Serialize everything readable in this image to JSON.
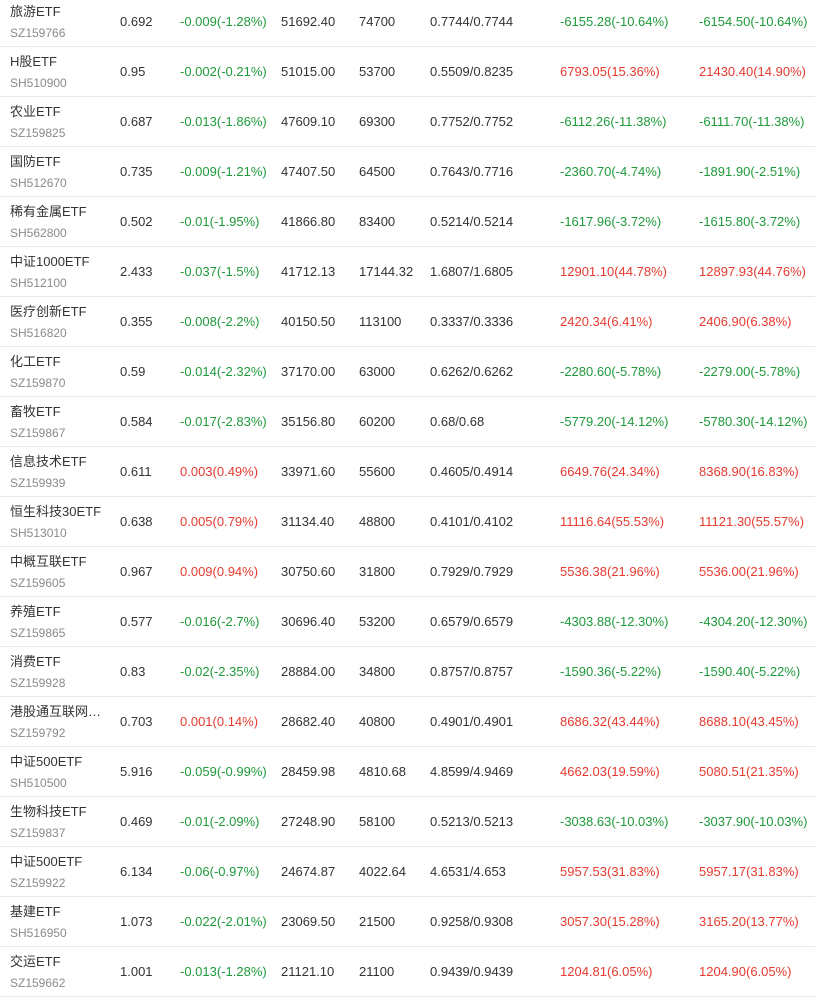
{
  "colors": {
    "up": "#e83a2e",
    "down": "#1f9a3b",
    "neutral": "#333333",
    "code_gray": "#8a8a8a",
    "divider": "#e8e8e8"
  },
  "rows": [
    {
      "name": "旅游ETF",
      "code": "SZ159766",
      "price": "0.692",
      "change": "-0.009(-1.28%)",
      "change_dir": "down",
      "market_value": "51692.40",
      "shares": "74700",
      "cost": "0.7744/0.7744",
      "pl1": "-6155.28(-10.64%)",
      "pl1_dir": "down",
      "pl2": "-6154.50(-10.64%)",
      "pl2_dir": "down"
    },
    {
      "name": "H股ETF",
      "code": "SH510900",
      "price": "0.95",
      "change": "-0.002(-0.21%)",
      "change_dir": "down",
      "market_value": "51015.00",
      "shares": "53700",
      "cost": "0.5509/0.8235",
      "pl1": "6793.05(15.36%)",
      "pl1_dir": "up",
      "pl2": "21430.40(14.90%)",
      "pl2_dir": "up"
    },
    {
      "name": "农业ETF",
      "code": "SZ159825",
      "price": "0.687",
      "change": "-0.013(-1.86%)",
      "change_dir": "down",
      "market_value": "47609.10",
      "shares": "69300",
      "cost": "0.7752/0.7752",
      "pl1": "-6112.26(-11.38%)",
      "pl1_dir": "down",
      "pl2": "-6111.70(-11.38%)",
      "pl2_dir": "down"
    },
    {
      "name": "国防ETF",
      "code": "SH512670",
      "price": "0.735",
      "change": "-0.009(-1.21%)",
      "change_dir": "down",
      "market_value": "47407.50",
      "shares": "64500",
      "cost": "0.7643/0.7716",
      "pl1": "-2360.70(-4.74%)",
      "pl1_dir": "down",
      "pl2": "-1891.90(-2.51%)",
      "pl2_dir": "down"
    },
    {
      "name": "稀有金属ETF",
      "code": "SH562800",
      "price": "0.502",
      "change": "-0.01(-1.95%)",
      "change_dir": "down",
      "market_value": "41866.80",
      "shares": "83400",
      "cost": "0.5214/0.5214",
      "pl1": "-1617.96(-3.72%)",
      "pl1_dir": "down",
      "pl2": "-1615.80(-3.72%)",
      "pl2_dir": "down"
    },
    {
      "name": "中证1000ETF",
      "code": "SH512100",
      "price": "2.433",
      "change": "-0.037(-1.5%)",
      "change_dir": "down",
      "market_value": "41712.13",
      "shares": "17144.32",
      "cost": "1.6807/1.6805",
      "pl1": "12901.10(44.78%)",
      "pl1_dir": "up",
      "pl2": "12897.93(44.76%)",
      "pl2_dir": "up"
    },
    {
      "name": "医疗创新ETF",
      "code": "SH516820",
      "price": "0.355",
      "change": "-0.008(-2.2%)",
      "change_dir": "down",
      "market_value": "40150.50",
      "shares": "113100",
      "cost": "0.3337/0.3336",
      "pl1": "2420.34(6.41%)",
      "pl1_dir": "up",
      "pl2": "2406.90(6.38%)",
      "pl2_dir": "up"
    },
    {
      "name": "化工ETF",
      "code": "SZ159870",
      "price": "0.59",
      "change": "-0.014(-2.32%)",
      "change_dir": "down",
      "market_value": "37170.00",
      "shares": "63000",
      "cost": "0.6262/0.6262",
      "pl1": "-2280.60(-5.78%)",
      "pl1_dir": "down",
      "pl2": "-2279.00(-5.78%)",
      "pl2_dir": "down"
    },
    {
      "name": "畜牧ETF",
      "code": "SZ159867",
      "price": "0.584",
      "change": "-0.017(-2.83%)",
      "change_dir": "down",
      "market_value": "35156.80",
      "shares": "60200",
      "cost": "0.68/0.68",
      "pl1": "-5779.20(-14.12%)",
      "pl1_dir": "down",
      "pl2": "-5780.30(-14.12%)",
      "pl2_dir": "down"
    },
    {
      "name": "信息技术ETF",
      "code": "SZ159939",
      "price": "0.611",
      "change": "0.003(0.49%)",
      "change_dir": "up",
      "market_value": "33971.60",
      "shares": "55600",
      "cost": "0.4605/0.4914",
      "pl1": "6649.76(24.34%)",
      "pl1_dir": "up",
      "pl2": "8368.90(16.83%)",
      "pl2_dir": "up"
    },
    {
      "name": "恒生科技30ETF",
      "code": "SH513010",
      "price": "0.638",
      "change": "0.005(0.79%)",
      "change_dir": "up",
      "market_value": "31134.40",
      "shares": "48800",
      "cost": "0.4101/0.4102",
      "pl1": "11116.64(55.53%)",
      "pl1_dir": "up",
      "pl2": "11121.30(55.57%)",
      "pl2_dir": "up"
    },
    {
      "name": "中概互联ETF",
      "code": "SZ159605",
      "price": "0.967",
      "change": "0.009(0.94%)",
      "change_dir": "up",
      "market_value": "30750.60",
      "shares": "31800",
      "cost": "0.7929/0.7929",
      "pl1": "5536.38(21.96%)",
      "pl1_dir": "up",
      "pl2": "5536.00(21.96%)",
      "pl2_dir": "up"
    },
    {
      "name": "养殖ETF",
      "code": "SZ159865",
      "price": "0.577",
      "change": "-0.016(-2.7%)",
      "change_dir": "down",
      "market_value": "30696.40",
      "shares": "53200",
      "cost": "0.6579/0.6579",
      "pl1": "-4303.88(-12.30%)",
      "pl1_dir": "down",
      "pl2": "-4304.20(-12.30%)",
      "pl2_dir": "down"
    },
    {
      "name": "消费ETF",
      "code": "SZ159928",
      "price": "0.83",
      "change": "-0.02(-2.35%)",
      "change_dir": "down",
      "market_value": "28884.00",
      "shares": "34800",
      "cost": "0.8757/0.8757",
      "pl1": "-1590.36(-5.22%)",
      "pl1_dir": "down",
      "pl2": "-1590.40(-5.22%)",
      "pl2_dir": "down"
    },
    {
      "name": "港股通互联网…",
      "code": "SZ159792",
      "price": "0.703",
      "change": "0.001(0.14%)",
      "change_dir": "up",
      "market_value": "28682.40",
      "shares": "40800",
      "cost": "0.4901/0.4901",
      "pl1": "8686.32(43.44%)",
      "pl1_dir": "up",
      "pl2": "8688.10(43.45%)",
      "pl2_dir": "up"
    },
    {
      "name": "中证500ETF",
      "code": "SH510500",
      "price": "5.916",
      "change": "-0.059(-0.99%)",
      "change_dir": "down",
      "market_value": "28459.98",
      "shares": "4810.68",
      "cost": "4.8599/4.9469",
      "pl1": "4662.03(19.59%)",
      "pl1_dir": "up",
      "pl2": "5080.51(21.35%)",
      "pl2_dir": "up"
    },
    {
      "name": "生物科技ETF",
      "code": "SZ159837",
      "price": "0.469",
      "change": "-0.01(-2.09%)",
      "change_dir": "down",
      "market_value": "27248.90",
      "shares": "58100",
      "cost": "0.5213/0.5213",
      "pl1": "-3038.63(-10.03%)",
      "pl1_dir": "down",
      "pl2": "-3037.90(-10.03%)",
      "pl2_dir": "down"
    },
    {
      "name": "中证500ETF",
      "code": "SZ159922",
      "price": "6.134",
      "change": "-0.06(-0.97%)",
      "change_dir": "down",
      "market_value": "24674.87",
      "shares": "4022.64",
      "cost": "4.6531/4.653",
      "pl1": "5957.53(31.83%)",
      "pl1_dir": "up",
      "pl2": "5957.17(31.83%)",
      "pl2_dir": "up"
    },
    {
      "name": "基建ETF",
      "code": "SH516950",
      "price": "1.073",
      "change": "-0.022(-2.01%)",
      "change_dir": "down",
      "market_value": "23069.50",
      "shares": "21500",
      "cost": "0.9258/0.9308",
      "pl1": "3057.30(15.28%)",
      "pl1_dir": "up",
      "pl2": "3165.20(13.77%)",
      "pl2_dir": "up"
    },
    {
      "name": "交运ETF",
      "code": "SZ159662",
      "price": "1.001",
      "change": "-0.013(-1.28%)",
      "change_dir": "down",
      "market_value": "21121.10",
      "shares": "21100",
      "cost": "0.9439/0.9439",
      "pl1": "1204.81(6.05%)",
      "pl1_dir": "up",
      "pl2": "1204.90(6.05%)",
      "pl2_dir": "up"
    }
  ]
}
